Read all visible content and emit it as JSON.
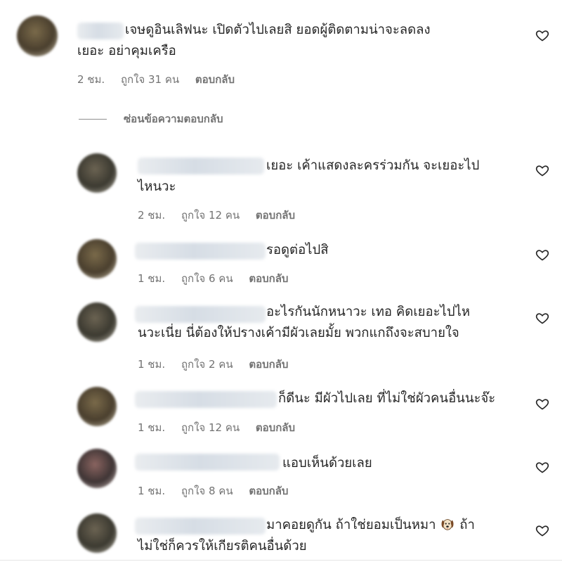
{
  "top_comment": {
    "text_line1": "เจษดูอินเลิฟนะ เปิดตัวไปเลยสิ ยอดผู้ติดตามน่าจะลดลง",
    "text_line2": "เยอะ อย่าคุมเครือ",
    "time": "2 ชม.",
    "likes": "ถูกใจ 31 คน",
    "reply": "ตอบกลับ"
  },
  "hide_replies_label": "ซ่อนข้อความตอบกลับ",
  "replies": [
    {
      "text_line1": "เยอะ เค้าแสดงละครร่วมกัน จะเยอะไป",
      "text_line2": "ไหนวะ",
      "time": "2 ชม.",
      "likes": "ถูกใจ 12 คน",
      "reply": "ตอบกลับ"
    },
    {
      "text_line1": "รอดูต่อไปสิ",
      "time": "1 ชม.",
      "likes": "ถูกใจ 6 คน",
      "reply": "ตอบกลับ"
    },
    {
      "text_line1": "อะไรกันนักหนาวะ เทอ คิดเยอะไปไห",
      "text_line2": "นวะเนี่ย นี่ต้องให้ปรางเค้ามีผัวเลยมั้ย พวกแกถึงจะสบายใจ",
      "time": "1 ชม.",
      "likes": "ถูกใจ 2 คน",
      "reply": "ตอบกลับ"
    },
    {
      "text_line1": "ก็ดีนะ มีผัวไปเลย ที่ไม่ใช่ผัวคนอื่นนะจ๊ะ",
      "time": "1 ชม.",
      "likes": "ถูกใจ 12 คน",
      "reply": "ตอบกลับ"
    },
    {
      "text_line1": "แอบเห็นด้วยเลย",
      "time": "1 ชม.",
      "likes": "ถูกใจ 8 คน",
      "reply": "ตอบกลับ"
    },
    {
      "text_line1_a": "มาคอยดูกัน ถ้าใช่ยอมเป็นหมา",
      "text_line1_b": "ถ้า",
      "text_line2": "ไม่ใช่ก็ควรให้เกียรติคนอื่นด้วย",
      "emoji": "dog-face-icon"
    }
  ],
  "icons": {
    "like": "heart-outline-icon"
  }
}
